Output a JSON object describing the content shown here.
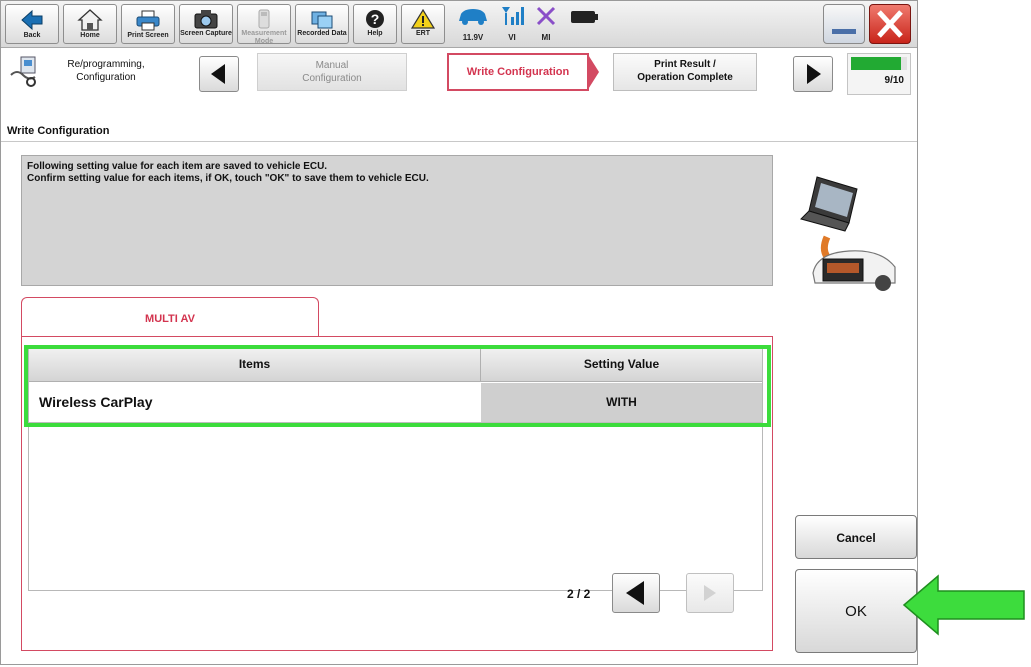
{
  "toolbar": {
    "back": "Back",
    "home": "Home",
    "print_screen": "Print Screen",
    "screen_capture": "Screen Capture",
    "measurement_mode": "Measurement Mode",
    "recorded_data": "Recorded Data",
    "help": "Help",
    "ert": "ERT",
    "voltage": "11.9V",
    "vi": "VI",
    "mi": "MI"
  },
  "steps": {
    "reprogramming": "Re/programming, Configuration",
    "manual_configuration": "Manual Configuration",
    "write_configuration": "Write Configuration",
    "print_result": "Print Result /",
    "operation_complete": "Operation Complete",
    "progress": "9/10",
    "progress_fraction": 0.9
  },
  "page": {
    "subtitle": "Write Configuration",
    "message_line1": "Following setting value for each item are saved to vehicle ECU.",
    "message_line2": "Confirm setting value for each items, if OK, touch \"OK\" to save them to vehicle ECU."
  },
  "tab": {
    "label": "MULTI AV"
  },
  "table": {
    "col_items": "Items",
    "col_setting": "Setting Value",
    "rows": [
      {
        "item": "Wireless CarPlay",
        "value": "WITH"
      }
    ]
  },
  "pager": {
    "label": "2 / 2"
  },
  "buttons": {
    "cancel": "Cancel",
    "ok": "OK"
  },
  "colors": {
    "accent_pink": "#d3344f",
    "highlight_green": "#3cdc3c",
    "progress_green": "#22aa33"
  }
}
